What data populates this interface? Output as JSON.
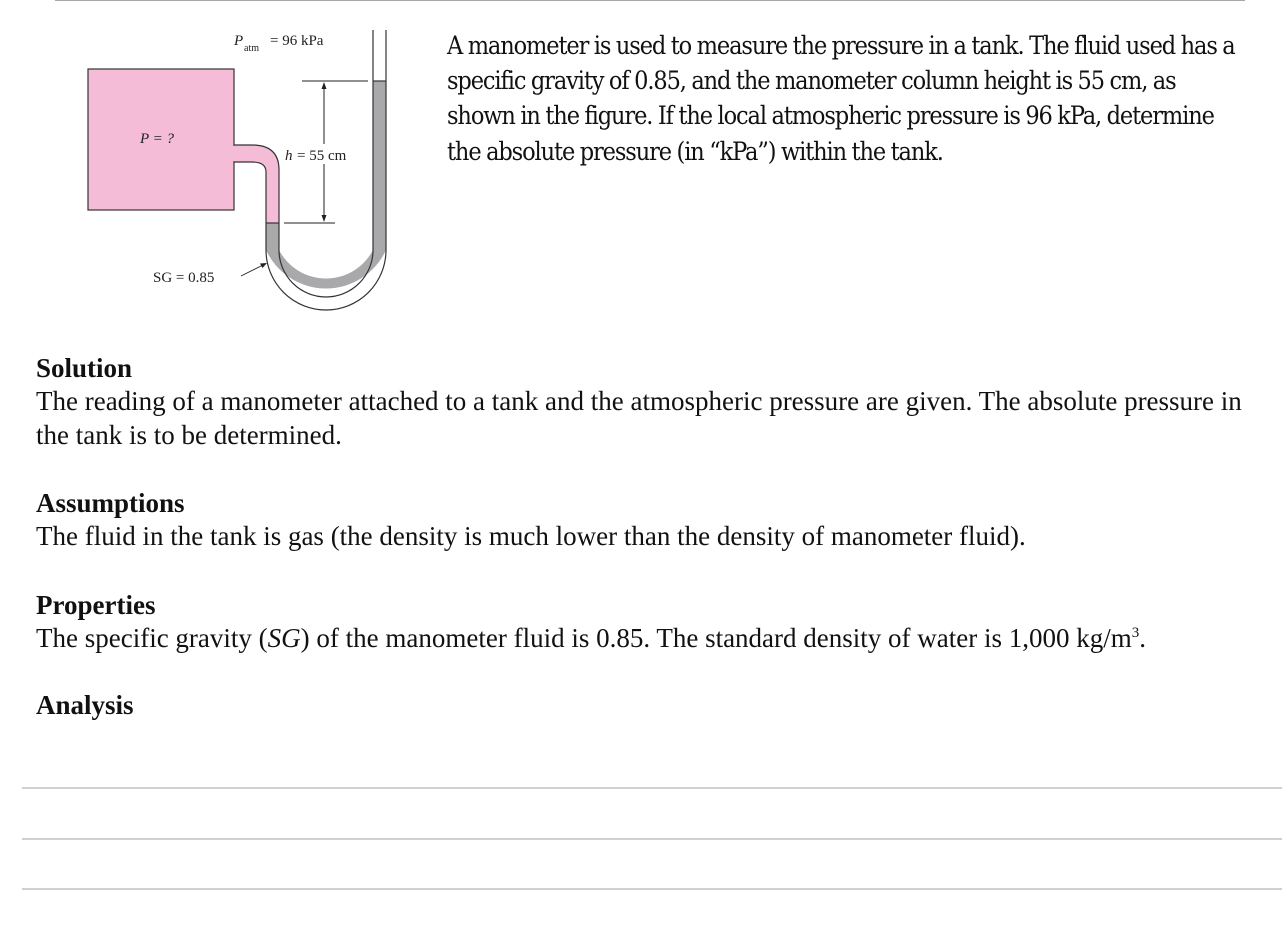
{
  "figure": {
    "patm_symbol": "P",
    "patm_subscript": "atm",
    "patm_value": "= 96 kPa",
    "tank_label": "P = ?",
    "height_symbol": "h",
    "height_value": "= 55 cm",
    "sg_label": "SG = 0.85",
    "colors": {
      "tank_fill": "#f4bcd6",
      "manometer_fluid": "#a9a9ab",
      "outline": "#333333"
    }
  },
  "problem": {
    "text": "A manometer is used to measure the pressure in a tank.  The fluid used has a specific gravity of 0.85, and the manometer column height is 55 cm, as shown in the figure.  If the local atmospheric pressure is 96 kPa, determine the absolute pressure (in “kPa”) within the tank."
  },
  "solution": {
    "heading": "Solution",
    "text": "The reading of a manometer attached to a tank and the atmospheric pressure are given.  The absolute pressure in the tank is to be determined."
  },
  "assumptions": {
    "heading": "Assumptions",
    "text": "The fluid in the tank is gas (the density is much lower than the density of manometer fluid)."
  },
  "properties": {
    "heading": "Properties",
    "text_before_sg": "The specific gravity (",
    "sg_italic": "SG",
    "text_after_sg": ") of the manometer fluid is 0.85.  The standard density of water is 1,000 kg/m",
    "superscript": "3",
    "text_end": "."
  },
  "analysis": {
    "heading": "Analysis",
    "answer_lines": 3
  }
}
